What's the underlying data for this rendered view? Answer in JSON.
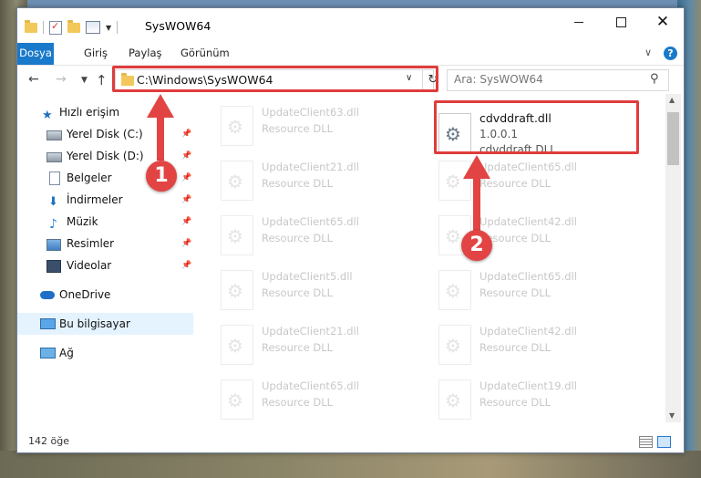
{
  "window": {
    "title": "SysWOW64"
  },
  "ribbon": {
    "tabs": [
      "Dosya",
      "Giriş",
      "Paylaş",
      "Görünüm"
    ],
    "help": "?"
  },
  "navigation": {
    "address": "C:\\Windows\\SysWOW64",
    "search_placeholder": "Ara: SysWOW64"
  },
  "sidebar": {
    "items": [
      {
        "label": "Hızlı erişim",
        "icon": "star-icon"
      },
      {
        "label": "Yerel Disk (C:)",
        "icon": "drive-icon",
        "pinned": true
      },
      {
        "label": "Yerel Disk (D:)",
        "icon": "drive-icon",
        "pinned": true
      },
      {
        "label": "Belgeler",
        "icon": "document-icon",
        "pinned": true
      },
      {
        "label": "İndirmeler",
        "icon": "download-icon",
        "pinned": true
      },
      {
        "label": "Müzik",
        "icon": "music-icon",
        "pinned": true
      },
      {
        "label": "Resimler",
        "icon": "picture-icon",
        "pinned": true
      },
      {
        "label": "Videolar",
        "icon": "video-icon",
        "pinned": true
      },
      {
        "label": "OneDrive",
        "icon": "cloud-icon"
      },
      {
        "label": "Bu bilgisayar",
        "icon": "computer-icon",
        "selected": true
      },
      {
        "label": "Ağ",
        "icon": "network-icon"
      }
    ]
  },
  "files": {
    "left_column": [
      {
        "name": "UpdateClient63.dll",
        "desc": "Resource DLL"
      },
      {
        "name": "UpdateClient21.dll",
        "desc": "Resource DLL"
      },
      {
        "name": "UpdateClient65.dll",
        "desc": "Resource DLL"
      },
      {
        "name": "UpdateClient5.dll",
        "desc": "Resource DLL"
      },
      {
        "name": "UpdateClient21.dll",
        "desc": "Resource DLL"
      },
      {
        "name": "UpdateClient65.dll",
        "desc": "Resource DLL"
      }
    ],
    "highlighted": {
      "name": "cdvddraft.dll",
      "version": "1.0.0.1",
      "desc": "cdvddraft DLL"
    },
    "right_column": [
      {
        "name": "UpdateClient65.dll",
        "desc": "Resource DLL"
      },
      {
        "name": "UpdateClient42.dll",
        "desc": "Resource DLL"
      },
      {
        "name": "UpdateClient65.dll",
        "desc": "Resource DLL"
      },
      {
        "name": "UpdateClient42.dll",
        "desc": "Resource DLL"
      },
      {
        "name": "UpdateClient19.dll",
        "desc": "Resource DLL"
      }
    ]
  },
  "status": {
    "item_count": "142 öğe"
  },
  "annotations": {
    "step1": "1",
    "step2": "2",
    "color": "#e24444"
  }
}
